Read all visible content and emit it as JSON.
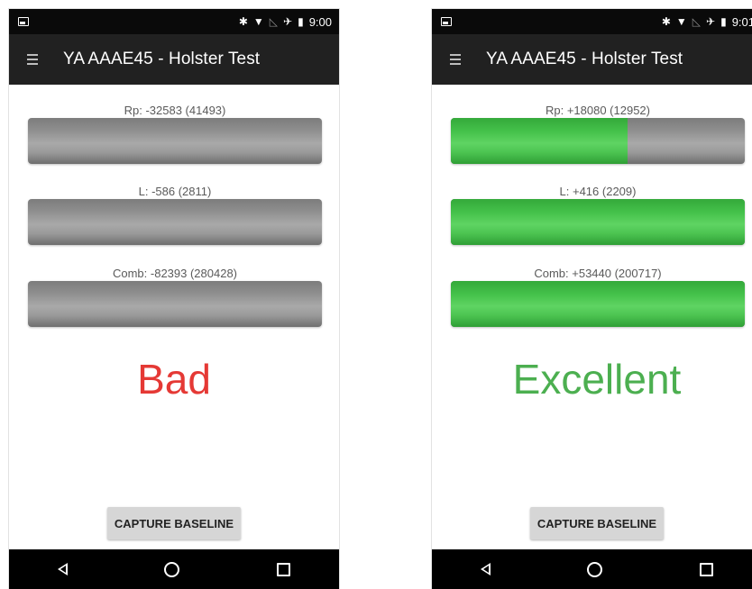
{
  "colors": {
    "bad": "#e53935",
    "excellent": "#4caf50",
    "fill_green": "#45c24b",
    "bar_gray": "#8d8d8d"
  },
  "screens": [
    {
      "status": {
        "time": "9:00",
        "icons": [
          "image-icon",
          "bluetooth-icon",
          "wifi-icon",
          "no-signal-icon",
          "airplane-icon",
          "battery-icon"
        ]
      },
      "app_title": "YA AAAE45 - Holster Test",
      "meters": [
        {
          "label": "Rp: -32583 (41493)",
          "fill_fraction": 0.0
        },
        {
          "label": "L: -586 (2811)",
          "fill_fraction": 0.0
        },
        {
          "label": "Comb: -82393 (280428)",
          "fill_fraction": 0.0
        }
      ],
      "verdict": "Bad",
      "verdict_color": "#e53935",
      "capture_button": "CAPTURE BASELINE"
    },
    {
      "status": {
        "time": "9:01",
        "icons": [
          "image-icon",
          "bluetooth-icon",
          "wifi-icon",
          "no-signal-icon",
          "airplane-icon",
          "battery-icon"
        ]
      },
      "app_title": "YA AAAE45 - Holster Test",
      "meters": [
        {
          "label": "Rp: +18080 (12952)",
          "fill_fraction": 0.6
        },
        {
          "label": "L: +416 (2209)",
          "fill_fraction": 1.0
        },
        {
          "label": "Comb: +53440 (200717)",
          "fill_fraction": 1.0
        }
      ],
      "verdict": "Excellent",
      "verdict_color": "#4caf50",
      "capture_button": "CAPTURE BASELINE"
    }
  ]
}
